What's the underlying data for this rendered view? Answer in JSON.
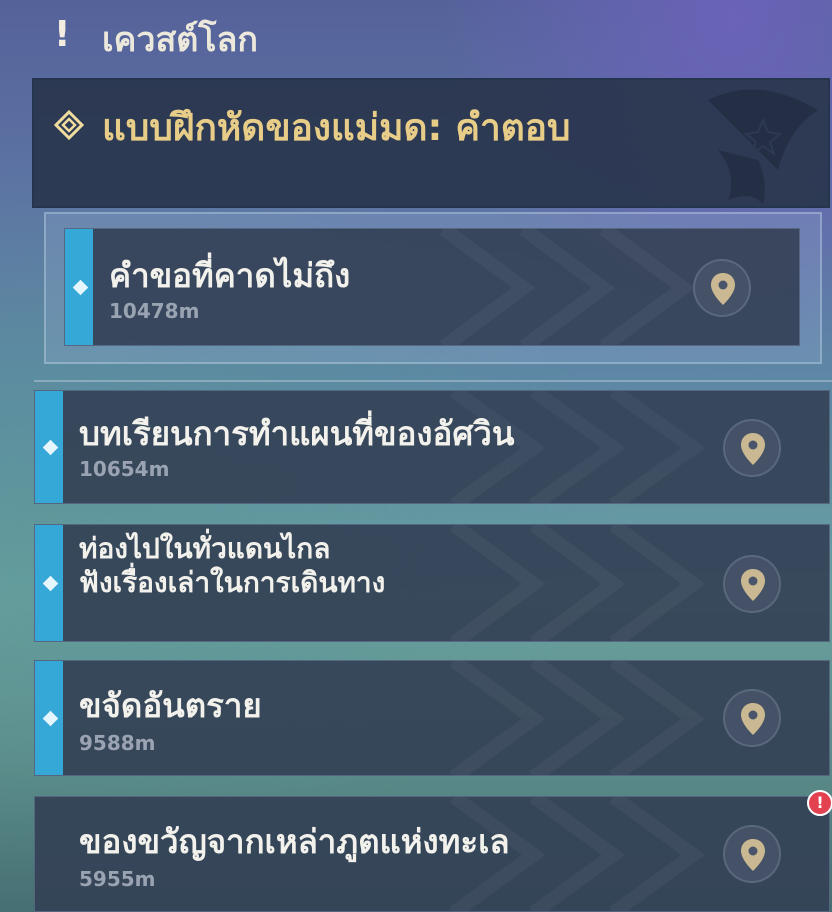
{
  "header": {
    "icon": "!",
    "title": "เควสต์โลก"
  },
  "parent_quest": {
    "icon_name": "quest-diamond-icon",
    "title": "แบบฝึกหัดของแม่มด: คำตอบ",
    "emblem_name": "witch-hat-emblem"
  },
  "quests": [
    {
      "title": "คำขอที่คาดไม่ถึง",
      "distance": "10478m",
      "selected": true,
      "pin_icon": "map-pin-icon"
    },
    {
      "title": "บทเรียนการทำแผนที่ของอัศวิน",
      "distance": "10654m",
      "pin_icon": "map-pin-icon"
    },
    {
      "title_lines": [
        "ท่องไปในทั่วแดนไกล",
        "ฟังเรื่องเล่าในการเดินทาง"
      ],
      "pin_icon": "map-pin-icon"
    },
    {
      "title": "ขจัดอันตราย",
      "distance": "9588m",
      "pin_icon": "map-pin-icon"
    },
    {
      "title": "ของขวัญจากเหล่าภูตแห่งทะเล",
      "distance": "5955m",
      "pin_icon": "map-pin-icon",
      "badge": "!"
    }
  ],
  "colors": {
    "accent": "#35a8d8",
    "parent_title": "#e8cd88",
    "alert": "#e3414f"
  }
}
